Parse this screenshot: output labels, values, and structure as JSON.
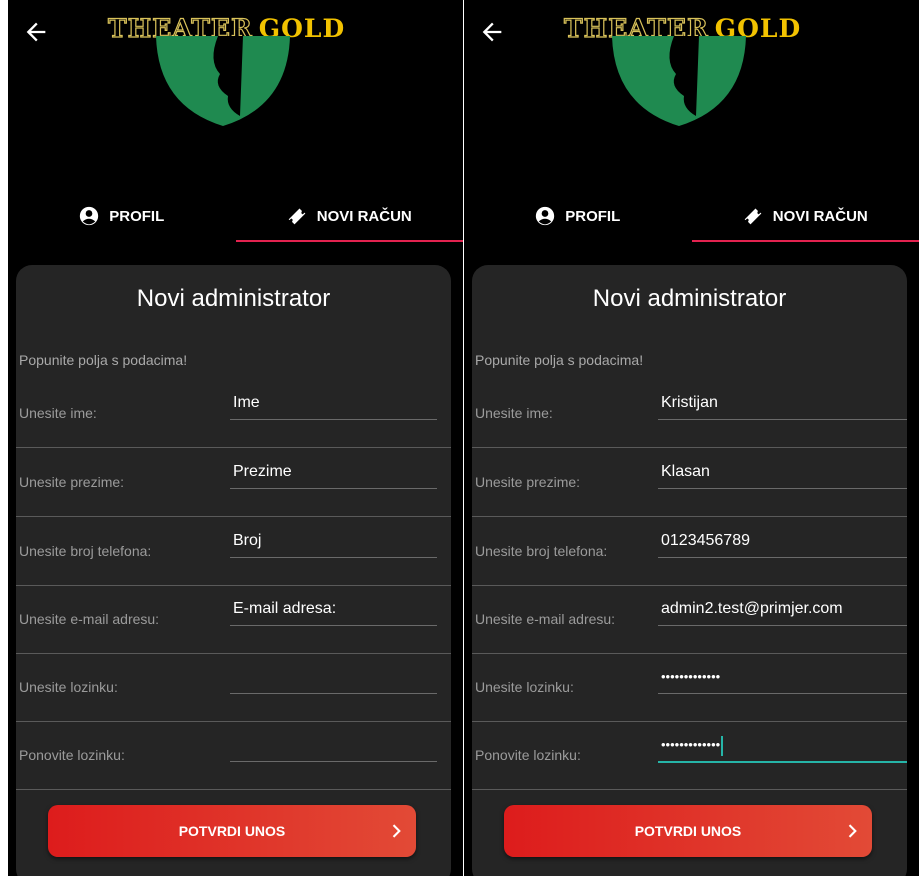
{
  "screens": [
    {
      "app_title_part1": "THEATER",
      "app_title_part2": "GOLD",
      "tabs": [
        {
          "label": "PROFIL",
          "icon": "account-circle-icon"
        },
        {
          "label": "NOVI RAČUN",
          "icon": "ticket-icon"
        }
      ],
      "active_tab": "NOVI RAČUN",
      "card_title": "Novi administrator",
      "hint": "Popunite polja s podacima!",
      "fields": [
        {
          "label": "Unesite ime:",
          "value": "",
          "placeholder": "Ime"
        },
        {
          "label": "Unesite prezime:",
          "value": "",
          "placeholder": "Prezime"
        },
        {
          "label": "Unesite broj telefona:",
          "value": "",
          "placeholder": "Broj"
        },
        {
          "label": "Unesite e-mail adresu:",
          "value": "",
          "placeholder": "E-mail adresa:"
        },
        {
          "label": "Unesite lozinku:",
          "value": "",
          "placeholder": ""
        },
        {
          "label": "Ponovite lozinku:",
          "value": "",
          "placeholder": ""
        }
      ],
      "submit_label": "POTVRDI UNOS"
    },
    {
      "app_title_part1": "THEATER",
      "app_title_part2": "GOLD",
      "tabs": [
        {
          "label": "PROFIL",
          "icon": "account-circle-icon"
        },
        {
          "label": "NOVI RAČUN",
          "icon": "ticket-icon"
        }
      ],
      "active_tab": "NOVI RAČUN",
      "card_title": "Novi administrator",
      "hint": "Popunite polja s podacima!",
      "fields": [
        {
          "label": "Unesite ime:",
          "value": "Kristijan",
          "placeholder": "Ime"
        },
        {
          "label": "Unesite prezime:",
          "value": "Klasan",
          "placeholder": "Prezime"
        },
        {
          "label": "Unesite broj telefona:",
          "value": "0123456789",
          "placeholder": "Broj"
        },
        {
          "label": "Unesite e-mail adresu:",
          "value": "admin2.test@primjer.com",
          "placeholder": "E-mail adresa:"
        },
        {
          "label": "Unesite lozinku:",
          "value": "•••••••••••••",
          "placeholder": ""
        },
        {
          "label": "Ponovite lozinku:",
          "value": "•••••••••••••",
          "placeholder": "",
          "focused": true
        }
      ],
      "submit_label": "POTVRDI UNOS"
    }
  ],
  "colors": {
    "accent": "#e3224f",
    "button_start": "#dd1c1c",
    "button_end": "#e24a36",
    "focus": "#26b5a8",
    "title_gold": "#f2c200",
    "logo_green": "#1f8a50"
  }
}
